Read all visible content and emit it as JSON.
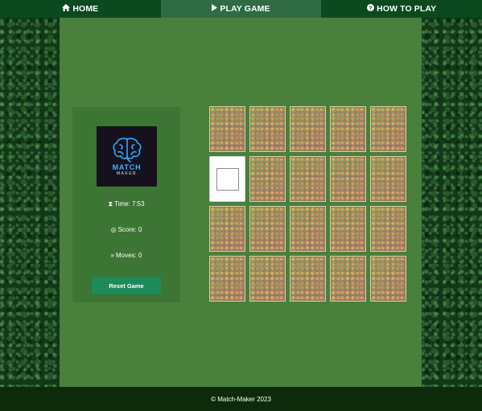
{
  "nav": {
    "items": [
      {
        "label": "Home",
        "icon": "home-icon",
        "active": false
      },
      {
        "label": "Play Game",
        "icon": "play-icon",
        "active": true
      },
      {
        "label": "How to Play",
        "icon": "question-circle-icon",
        "active": false
      }
    ]
  },
  "panel": {
    "logo": {
      "word": "MATCH",
      "sub": "MAKER"
    },
    "time_label": "Time: 7:53",
    "score_label": "Score: 0",
    "moves_label": "Moves: 0",
    "reset_label": "Reset Game"
  },
  "board": {
    "columns": 5,
    "rows": 4,
    "flipped_card_index": 5
  },
  "footer": {
    "text": "© Match-Maker 2023"
  },
  "colors": {
    "nav_bg": "#0b4a1f",
    "nav_active": "#2f6b44",
    "main_bg": "#48803c",
    "panel_bg": "#3d7534",
    "reset_button": "#1e8a5a",
    "footer_bg": "#0d2a0a"
  }
}
